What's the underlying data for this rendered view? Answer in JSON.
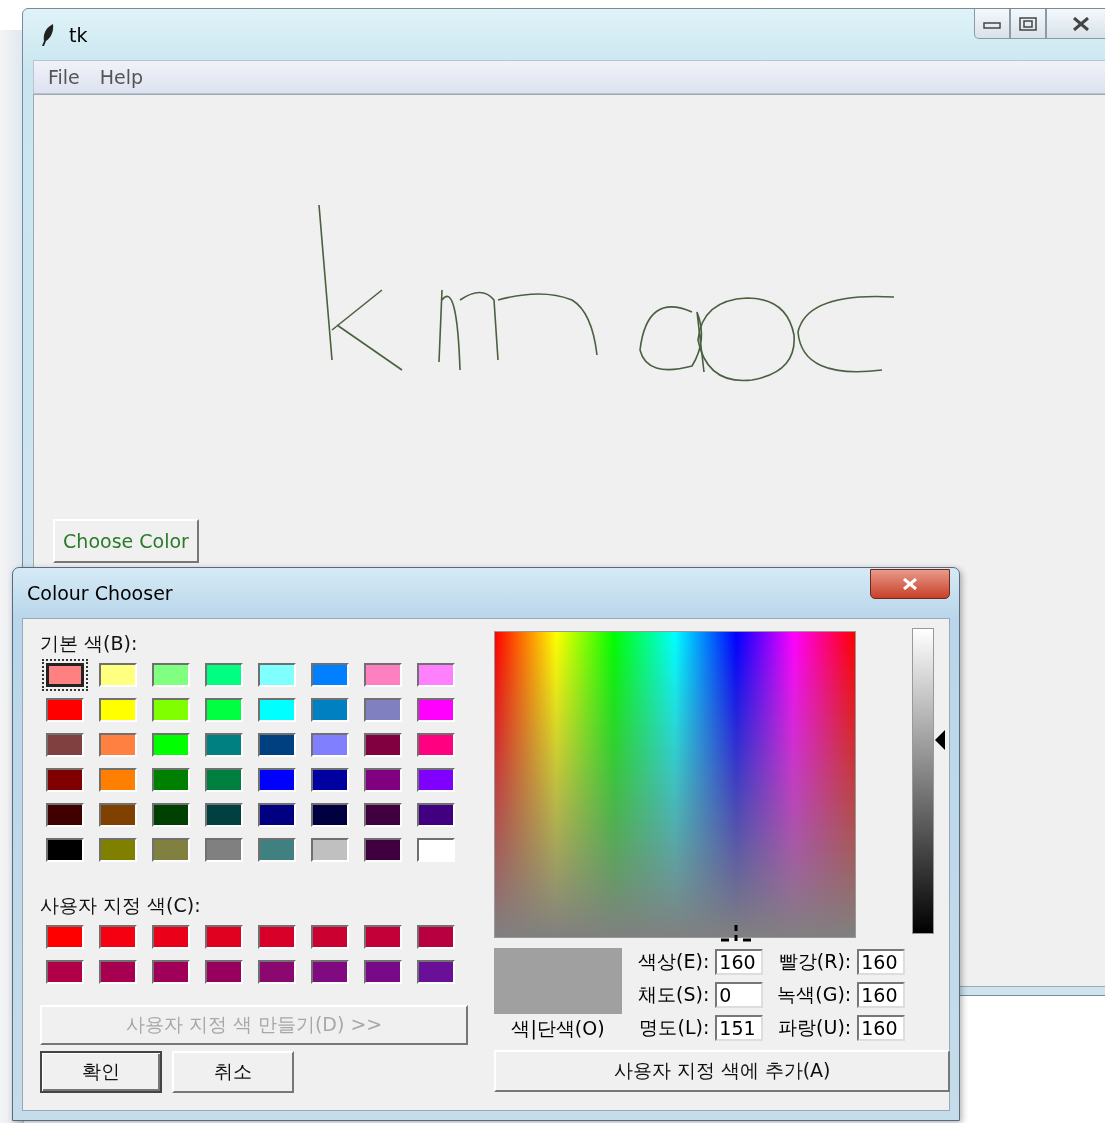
{
  "main_window": {
    "title": "tk",
    "menu": [
      "File",
      "Help"
    ],
    "button": "Choose Color"
  },
  "dialog": {
    "title": "Colour Chooser",
    "basic_label": "기본 색(B):",
    "basic_colors": [
      {
        "color": "#ff8080",
        "selected": true
      },
      {
        "color": "#ffff80",
        "selected": false
      },
      {
        "color": "#80ff80",
        "selected": false
      },
      {
        "color": "#00ff80",
        "selected": false
      },
      {
        "color": "#80ffff",
        "selected": false
      },
      {
        "color": "#0080ff",
        "selected": false
      },
      {
        "color": "#ff80c0",
        "selected": false
      },
      {
        "color": "#ff80ff",
        "selected": false
      },
      {
        "color": "#ff0000",
        "selected": false
      },
      {
        "color": "#ffff00",
        "selected": false
      },
      {
        "color": "#80ff00",
        "selected": false
      },
      {
        "color": "#00ff40",
        "selected": false
      },
      {
        "color": "#00ffff",
        "selected": false
      },
      {
        "color": "#0080c0",
        "selected": false
      },
      {
        "color": "#8080c0",
        "selected": false
      },
      {
        "color": "#ff00ff",
        "selected": false
      },
      {
        "color": "#804040",
        "selected": false
      },
      {
        "color": "#ff8040",
        "selected": false
      },
      {
        "color": "#00ff00",
        "selected": false
      },
      {
        "color": "#008080",
        "selected": false
      },
      {
        "color": "#004080",
        "selected": false
      },
      {
        "color": "#8080ff",
        "selected": false
      },
      {
        "color": "#800040",
        "selected": false
      },
      {
        "color": "#ff0080",
        "selected": false
      },
      {
        "color": "#800000",
        "selected": false
      },
      {
        "color": "#ff8000",
        "selected": false
      },
      {
        "color": "#008000",
        "selected": false
      },
      {
        "color": "#008040",
        "selected": false
      },
      {
        "color": "#0000ff",
        "selected": false
      },
      {
        "color": "#0000a0",
        "selected": false
      },
      {
        "color": "#800080",
        "selected": false
      },
      {
        "color": "#8000ff",
        "selected": false
      },
      {
        "color": "#400000",
        "selected": false
      },
      {
        "color": "#804000",
        "selected": false
      },
      {
        "color": "#004000",
        "selected": false
      },
      {
        "color": "#004040",
        "selected": false
      },
      {
        "color": "#000080",
        "selected": false
      },
      {
        "color": "#000040",
        "selected": false
      },
      {
        "color": "#400040",
        "selected": false
      },
      {
        "color": "#400080",
        "selected": false
      },
      {
        "color": "#000000",
        "selected": false
      },
      {
        "color": "#808000",
        "selected": false
      },
      {
        "color": "#808040",
        "selected": false
      },
      {
        "color": "#808080",
        "selected": false
      },
      {
        "color": "#408080",
        "selected": false
      },
      {
        "color": "#c0c0c0",
        "selected": false
      },
      {
        "color": "#400040",
        "selected": false
      },
      {
        "color": "#ffffff",
        "selected": false
      }
    ],
    "custom_label": "사용자 지정 색(C):",
    "custom_colors": [
      {
        "color": "#ff0000"
      },
      {
        "color": "#f50010"
      },
      {
        "color": "#ea0018"
      },
      {
        "color": "#e00020"
      },
      {
        "color": "#d80028"
      },
      {
        "color": "#cc0030"
      },
      {
        "color": "#c40038"
      },
      {
        "color": "#b80040"
      },
      {
        "color": "#b00048"
      },
      {
        "color": "#a80050"
      },
      {
        "color": "#a00058"
      },
      {
        "color": "#980060"
      },
      {
        "color": "#8a0870"
      },
      {
        "color": "#800a80"
      },
      {
        "color": "#780a88"
      },
      {
        "color": "#6a0f98"
      }
    ],
    "define_button": {
      "label": "사용자 지정 색 만들기(D) >>",
      "disabled": true
    },
    "ok_button": "확인",
    "cancel_button": "취소",
    "luminance": {
      "level": 0.63
    },
    "solid_label": "색|단색(O)",
    "fields": [
      {
        "label": "색상(E):",
        "value": "160"
      },
      {
        "label": "빨강(R):",
        "value": "160"
      },
      {
        "label": "채도(S):",
        "value": "0"
      },
      {
        "label": "녹색(G):",
        "value": "160"
      },
      {
        "label": "명도(L):",
        "value": "151"
      },
      {
        "label": "파랑(U):",
        "value": "160"
      }
    ],
    "add_button": "사용자 지정 색에 추가(A)"
  }
}
